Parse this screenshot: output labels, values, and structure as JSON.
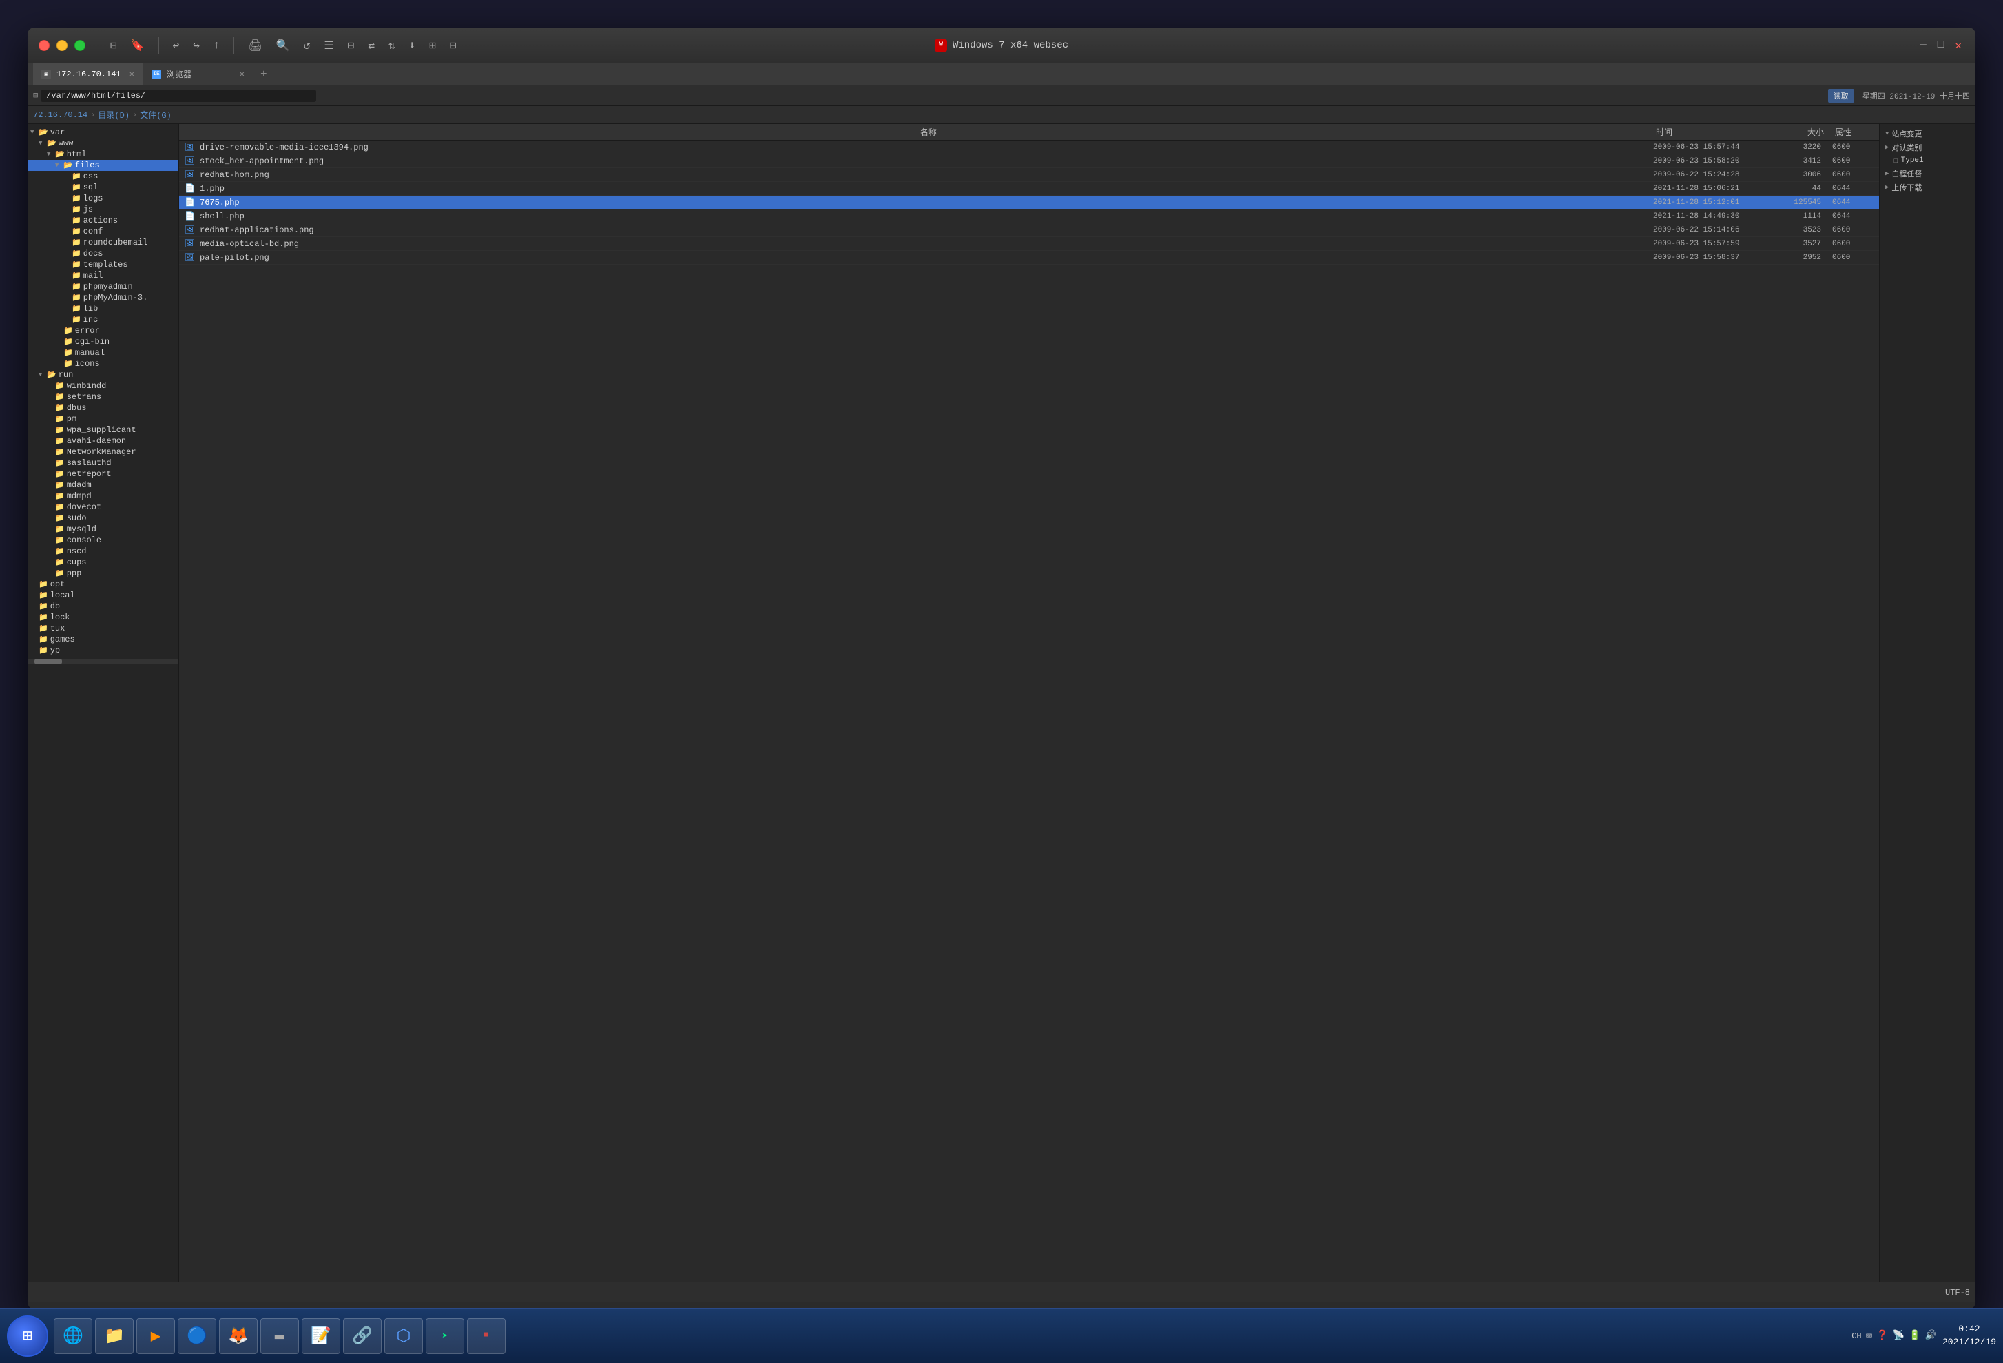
{
  "window": {
    "title": "Windows 7 x64 websec",
    "tabs": [
      {
        "id": "tab1",
        "label": "172.16.70.141",
        "icon": "terminal",
        "active": true
      },
      {
        "label": "浏览器",
        "icon": "browser",
        "active": false
      }
    ]
  },
  "address": {
    "path": "/var/www/html/files/"
  },
  "breadcrumb": {
    "parts": [
      "72.16.70.14",
      "目录(D)",
      "文件(G)"
    ]
  },
  "columns": {
    "name": "名称",
    "date": "时间",
    "size": "大小",
    "perms": "属性"
  },
  "file_tree": {
    "items": [
      {
        "id": "var",
        "label": "var",
        "level": 1,
        "type": "folder",
        "expanded": true
      },
      {
        "id": "www",
        "label": "www",
        "level": 2,
        "type": "folder",
        "expanded": true
      },
      {
        "id": "html",
        "label": "html",
        "level": 3,
        "type": "folder",
        "expanded": true
      },
      {
        "id": "files",
        "label": "files",
        "level": 4,
        "type": "folder-open",
        "expanded": true,
        "selected": true
      },
      {
        "id": "css",
        "label": "css",
        "level": 5,
        "type": "folder"
      },
      {
        "id": "sql",
        "label": "sql",
        "level": 5,
        "type": "folder"
      },
      {
        "id": "logs",
        "label": "logs",
        "level": 5,
        "type": "folder"
      },
      {
        "id": "js",
        "label": "js",
        "level": 5,
        "type": "folder"
      },
      {
        "id": "actions",
        "label": "actions",
        "level": 5,
        "type": "folder"
      },
      {
        "id": "conf",
        "label": "conf",
        "level": 5,
        "type": "folder"
      },
      {
        "id": "roundcubemail",
        "label": "roundcubemail",
        "level": 5,
        "type": "folder"
      },
      {
        "id": "docs",
        "label": "docs",
        "level": 5,
        "type": "folder"
      },
      {
        "id": "templates",
        "label": "templates",
        "level": 5,
        "type": "folder"
      },
      {
        "id": "mail",
        "label": "mail",
        "level": 5,
        "type": "folder"
      },
      {
        "id": "phpmyadmin",
        "label": "phpmyadmin",
        "level": 5,
        "type": "folder"
      },
      {
        "id": "phpMyAdmin-3",
        "label": "phpMyAdmin-3.",
        "level": 5,
        "type": "folder"
      },
      {
        "id": "lib",
        "label": "lib",
        "level": 5,
        "type": "folder"
      },
      {
        "id": "inc",
        "label": "inc",
        "level": 5,
        "type": "folder"
      },
      {
        "id": "error",
        "label": "error",
        "level": 4,
        "type": "folder"
      },
      {
        "id": "cgi-bin",
        "label": "cgi-bin",
        "level": 4,
        "type": "folder"
      },
      {
        "id": "manual",
        "label": "manual",
        "level": 4,
        "type": "folder"
      },
      {
        "id": "icons",
        "label": "icons",
        "level": 4,
        "type": "folder"
      },
      {
        "id": "run",
        "label": "run",
        "level": 2,
        "type": "folder",
        "expanded": true
      },
      {
        "id": "winbindd",
        "label": "winbindd",
        "level": 3,
        "type": "folder"
      },
      {
        "id": "setrans",
        "label": "setrans",
        "level": 3,
        "type": "folder"
      },
      {
        "id": "dbus",
        "label": "dbus",
        "level": 3,
        "type": "folder"
      },
      {
        "id": "pm",
        "label": "pm",
        "level": 3,
        "type": "folder"
      },
      {
        "id": "wpa_supplicant",
        "label": "wpa_supplicant",
        "level": 3,
        "type": "folder"
      },
      {
        "id": "avahi-daemon",
        "label": "avahi-daemon",
        "level": 3,
        "type": "folder"
      },
      {
        "id": "NetworkManager",
        "label": "NetworkManager",
        "level": 3,
        "type": "folder"
      },
      {
        "id": "saslauthd",
        "label": "saslauthd",
        "level": 3,
        "type": "folder"
      },
      {
        "id": "netreport",
        "label": "netreport",
        "level": 3,
        "type": "folder"
      },
      {
        "id": "mdadm",
        "label": "mdadm",
        "level": 3,
        "type": "folder"
      },
      {
        "id": "mdmpd",
        "label": "mdmpd",
        "level": 3,
        "type": "folder"
      },
      {
        "id": "dovecot",
        "label": "dovecot",
        "level": 3,
        "type": "folder"
      },
      {
        "id": "sudo",
        "label": "sudo",
        "level": 3,
        "type": "folder"
      },
      {
        "id": "mysqld",
        "label": "mysqld",
        "level": 3,
        "type": "folder"
      },
      {
        "id": "console",
        "label": "console",
        "level": 3,
        "type": "folder"
      },
      {
        "id": "nscd",
        "label": "nscd",
        "level": 3,
        "type": "folder"
      },
      {
        "id": "cups",
        "label": "cups",
        "level": 3,
        "type": "folder"
      },
      {
        "id": "ppp",
        "label": "ppp",
        "level": 3,
        "type": "folder"
      },
      {
        "id": "opt",
        "label": "opt",
        "level": 1,
        "type": "folder"
      },
      {
        "id": "local",
        "label": "local",
        "level": 1,
        "type": "folder"
      },
      {
        "id": "db",
        "label": "db",
        "level": 1,
        "type": "folder"
      },
      {
        "id": "lock",
        "label": "lock",
        "level": 1,
        "type": "folder"
      },
      {
        "id": "tux",
        "label": "tux",
        "level": 1,
        "type": "folder"
      },
      {
        "id": "games",
        "label": "games",
        "level": 1,
        "type": "folder"
      },
      {
        "id": "yp",
        "label": "yp",
        "level": 1,
        "type": "folder"
      }
    ]
  },
  "file_list": {
    "items": [
      {
        "name": "drive-removable-media-ieee1394.png",
        "date": "2009-06-23 15:57:44",
        "size": "3220",
        "perms": "0600",
        "type": "png"
      },
      {
        "name": "stock_her-appointment.png",
        "date": "2009-06-23 15:58:20",
        "size": "3412",
        "perms": "0600",
        "type": "png"
      },
      {
        "name": "redhat-hom.png",
        "date": "2009-06-22 15:24:28",
        "size": "3006",
        "perms": "0600",
        "type": "png"
      },
      {
        "name": "1.php",
        "date": "2021-11-28 15:06:21",
        "size": "44",
        "perms": "0644",
        "type": "php"
      },
      {
        "name": "7675.php",
        "date": "2021-11-28 15:12:01",
        "size": "125545",
        "perms": "0644",
        "type": "php",
        "selected": true
      },
      {
        "name": "shell.php",
        "date": "2021-11-28 14:49:30",
        "size": "1114",
        "perms": "0644",
        "type": "php"
      },
      {
        "name": "redhat-applications.png",
        "date": "2009-06-22 15:14:06",
        "size": "3523",
        "perms": "0600",
        "type": "png"
      },
      {
        "name": "media-optical-bd.png",
        "date": "2009-06-23 15:57:59",
        "size": "3527",
        "perms": "0600",
        "type": "png"
      },
      {
        "name": "pale-pilot.png",
        "date": "2009-06-23 15:58:37",
        "size": "2952",
        "perms": "0600",
        "type": "png"
      }
    ]
  },
  "right_sidebar": {
    "title": "站点变更",
    "sections": [
      {
        "label": "对认类别",
        "expanded": false,
        "items": [
          {
            "label": "Type1"
          }
        ]
      },
      {
        "label": "白程任督",
        "expanded": false
      },
      {
        "label": "上传下载",
        "expanded": false
      }
    ]
  },
  "header_buttons": {
    "read": "读取",
    "date_display": "星期四 2021-12-19 十月十四"
  },
  "status_bar": {
    "encoding": "UTF-8"
  },
  "taskbar": {
    "time": "0:42",
    "date": "2021/12/19",
    "start_label": "⊞",
    "items": [
      {
        "id": "start",
        "icon": "⊞",
        "type": "start"
      },
      {
        "id": "ie",
        "icon": "🌐"
      },
      {
        "id": "explorer",
        "icon": "📁"
      },
      {
        "id": "media",
        "icon": "▶"
      },
      {
        "id": "chrome",
        "icon": "🔵"
      },
      {
        "id": "firefox",
        "icon": "🦊"
      },
      {
        "id": "terminal",
        "icon": "▬"
      },
      {
        "id": "notepad",
        "icon": "📝"
      },
      {
        "id": "network",
        "icon": "🔗"
      },
      {
        "id": "cube",
        "icon": "⬡"
      },
      {
        "id": "cmd",
        "icon": ">"
      },
      {
        "id": "app",
        "icon": "▪"
      }
    ],
    "systray": {
      "ch": "CH",
      "keyboard": "⌨"
    }
  }
}
